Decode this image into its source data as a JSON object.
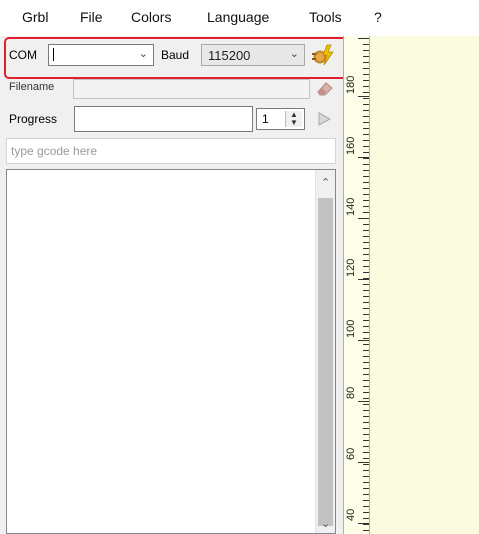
{
  "menu": [
    "Grbl",
    "File",
    "Colors",
    "Language",
    "Tools",
    "?"
  ],
  "connection": {
    "com_label": "COM",
    "com_value": "",
    "baud_label": "Baud",
    "baud_value": "115200"
  },
  "file": {
    "filename_label": "Filename",
    "filename_value": ""
  },
  "progress": {
    "label": "Progress",
    "copies_value": "1"
  },
  "gcode": {
    "placeholder": "type gcode here"
  },
  "ruler": {
    "labels": [
      "180",
      "160",
      "140",
      "120",
      "100",
      "80",
      "60",
      "40"
    ]
  },
  "colors": {
    "highlight": "#e0202a",
    "canvas_bg": "#fafbdf",
    "panel_bg": "#f0f0f0"
  },
  "icons": {
    "connect": "lightning-plug-icon",
    "eraser": "eraser-icon",
    "play": "play-icon",
    "up": "up-arrow-icon",
    "down": "down-arrow-icon"
  }
}
